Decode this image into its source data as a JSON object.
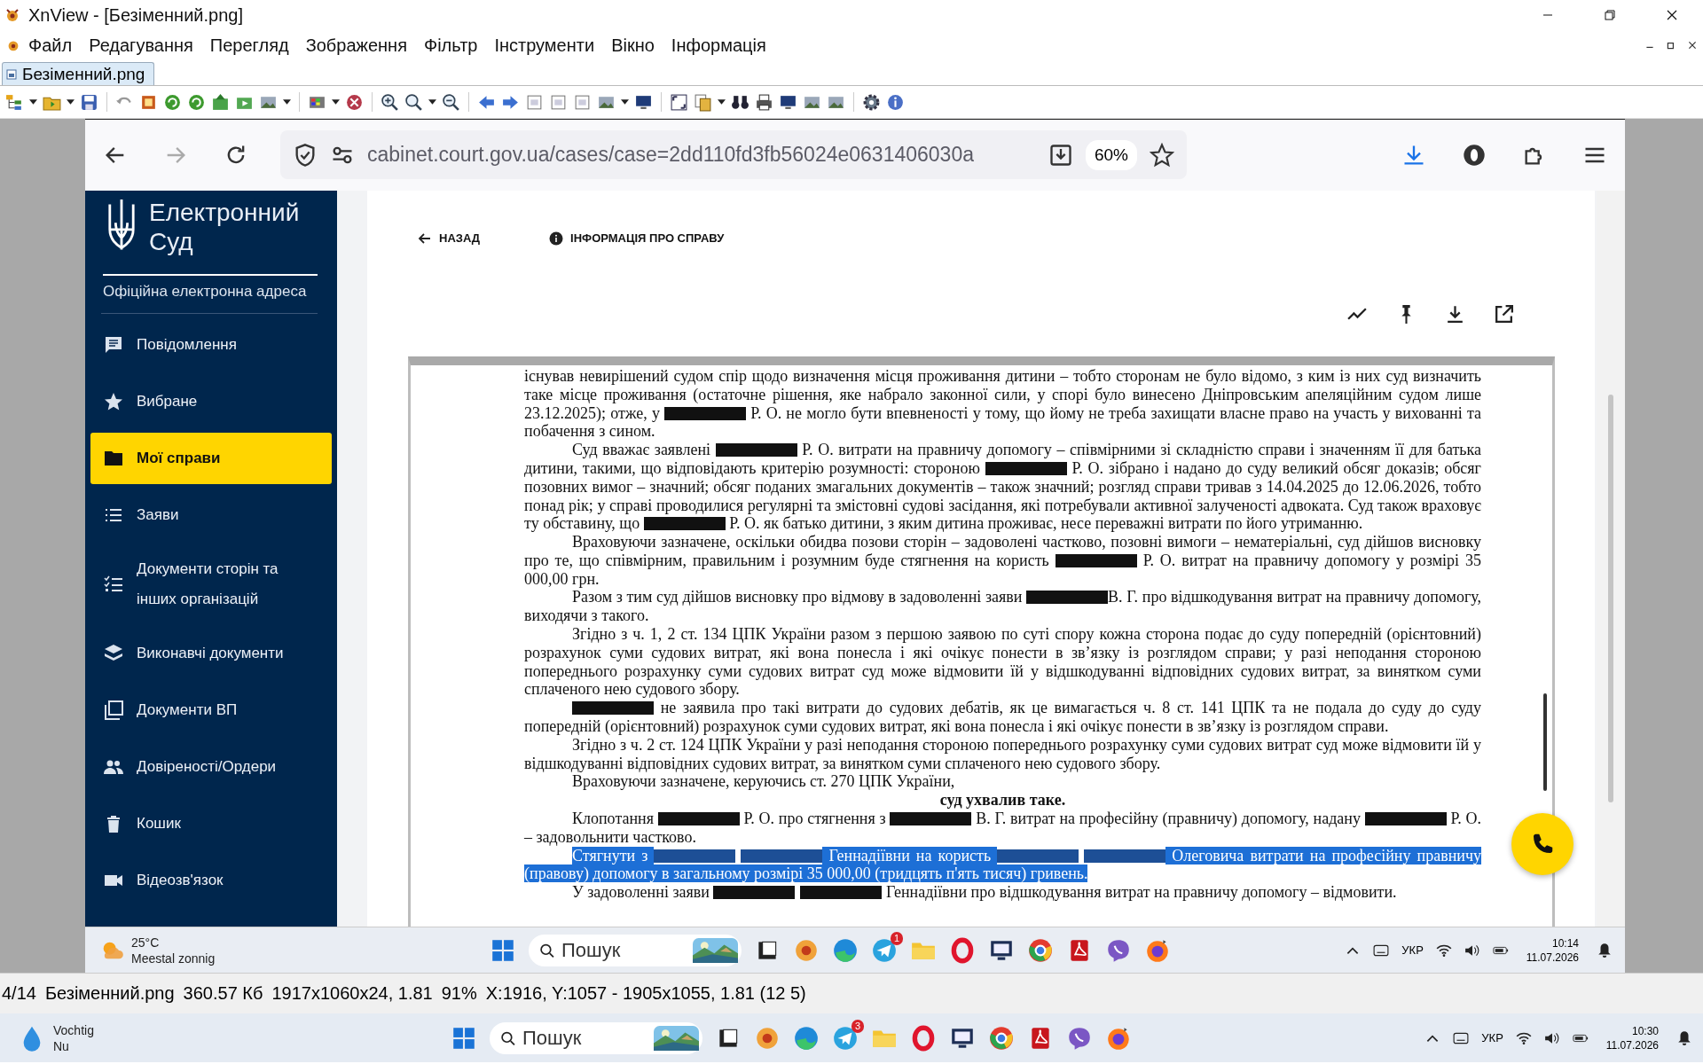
{
  "window": {
    "title": "XnView - [Безіменний.png]"
  },
  "menu": [
    "Файл",
    "Редагування",
    "Перегляд",
    "Зображення",
    "Фільтр",
    "Інструменти",
    "Вікно",
    "Інформація"
  ],
  "tabs": [
    {
      "label": "Безіменний.png",
      "selected": true
    }
  ],
  "browser": {
    "forward_disabled": true,
    "url": "cabinet.court.gov.ua/cases/case=2dd110fd3fb56024e0631406030a",
    "zoom": "60%"
  },
  "sidebar": {
    "logo_lines": [
      "Електронний",
      "Суд"
    ],
    "subtitle": "Офіційна електронна адреса",
    "items": [
      {
        "label": "Повідомлення",
        "selected": false
      },
      {
        "label": "Вибране",
        "selected": false
      },
      {
        "label": "Мої справи",
        "selected": true
      },
      {
        "label": "Заяви",
        "selected": false
      },
      {
        "label": "Документи сторін та інших організацій",
        "selected": false
      },
      {
        "label": "Виконавчі документи",
        "selected": false
      },
      {
        "label": "Документи ВП",
        "selected": false
      },
      {
        "label": "Довіреності/Ордери",
        "selected": false
      },
      {
        "label": "Кошик",
        "selected": false
      },
      {
        "label": "Відеозв'язок",
        "selected": false
      }
    ]
  },
  "page": {
    "back": "НАЗАД",
    "info": "ІНФОРМАЦІЯ ПРО СПРАВУ"
  },
  "document": {
    "paragraphs": [
      {
        "kind": "continuation",
        "highlighted": false,
        "parts": [
          "існував невирішений судом спір щодо визначення місця проживання дитини – тобто сторонам не було відомо, з ким із них суд визначить таке місце проживання (остаточне рішення, яке набрало законної сили, у спорі було винесено Дніпровським апеляційним судом лише 23.12.2025); отже, у ",
          {
            "kind": "redaction"
          },
          " Р. О. не могло бути впевненості у тому, що йому не треба захищати власне право на участь у вихованні та побачення з сином."
        ]
      },
      {
        "kind": "paragraph",
        "highlighted": false,
        "parts": [
          "Суд вважає заявлені ",
          {
            "kind": "redaction"
          },
          " Р. О. витрати на правничу допомогу – співмірними зі складністю справи і значенням її для батька дитини, такими, що відповідають критерію розумності: стороною ",
          {
            "kind": "redaction"
          },
          " Р. О. зібрано і надано до суду великий обсяг доказів; обсяг позовних вимог – значний; обсяг поданих змагальних документів – також значний; розгляд справи тривав з 14.04.2025 до 12.06.2026, тобто понад рік; у справі проводилися регулярні та змістовні судові засідання, які потребували активної залученості адвоката. Суд також враховує ту обставину, що ",
          {
            "kind": "redaction"
          },
          " Р. О. як батько дитини, з яким дитина проживає, несе переважні витрати по його утриманню."
        ]
      },
      {
        "kind": "paragraph",
        "highlighted": false,
        "parts": [
          "Враховуючи зазначене, оскільки обидва позови сторін – задоволені частково, позовні вимоги – нематеріальні, суд дійшов висновку про те, що співмірним, правильним і розумним буде стягнення на користь ",
          {
            "kind": "redaction"
          },
          " Р. О. витрат на правничу допомогу у розмірі 35 000,00 грн."
        ]
      },
      {
        "kind": "paragraph",
        "highlighted": false,
        "parts": [
          "Разом з тим суд дійшов висновку про відмову в задоволенні заяви ",
          {
            "kind": "redaction"
          },
          "В. Г. про відшкодування витрат на правничу допомогу, виходячи з такого."
        ]
      },
      {
        "kind": "paragraph",
        "highlighted": false,
        "parts": [
          "Згідно з ч. 1, 2 ст. 134 ЦПК України разом з першою заявою по суті спору кожна сторона подає до суду попередній (орієнтовний) розрахунок суми судових витрат, які вона понесла і які очікує понести в зв’язку із розглядом справи; у разі неподання стороною попереднього розрахунку суми судових витрат суд може відмовити їй у відшкодуванні відповідних судових витрат, за винятком суми сплаченого нею судового збору."
        ]
      },
      {
        "kind": "paragraph",
        "highlighted": false,
        "parts": [
          {
            "kind": "redaction"
          },
          " не заявила про такі витрати до судових дебатів, як це вимагається ч. 8 ст. 141 ЦПК та не подала до суду до суду попередній (орієнтовний) розрахунок суми судових витрат, які вона понесла і які очікує понести в зв’язку із розглядом справи."
        ]
      },
      {
        "kind": "paragraph",
        "highlighted": false,
        "parts": [
          "Згідно з ч. 2 ст. 124 ЦПК України у разі неподання стороною попереднього розрахунку суми судових витрат суд може відмовити їй у відшкодуванні відповідних судових витрат, за винятком суми сплаченого нею судового збору."
        ]
      },
      {
        "kind": "paragraph",
        "highlighted": false,
        "parts": [
          "Враховуючи зазначене, керуючись ст. 270 ЦПК України,"
        ]
      },
      {
        "kind": "heading",
        "highlighted": false,
        "parts": [
          "суд ухвалив таке."
        ]
      },
      {
        "kind": "paragraph",
        "highlighted": false,
        "parts": [
          "Клопотання ",
          {
            "kind": "redaction"
          },
          " Р. О. про стягнення з ",
          {
            "kind": "redaction"
          },
          " В. Г. витрат на професійну (правничу) допомогу, надану ",
          {
            "kind": "redaction"
          },
          " Р. О. – задовольнити частково."
        ]
      },
      {
        "kind": "paragraph",
        "highlighted": true,
        "parts": [
          "Стягнути з ",
          {
            "kind": "redaction"
          },
          {
            "kind": "redaction"
          },
          " Геннадіївни на користь ",
          {
            "kind": "redaction"
          },
          {
            "kind": "redaction"
          },
          " Олеговича витрати на професійну правничу (правову) допомогу в загальному розмірі 35 000,00 (тридцять п'ять тисяч) гривень."
        ]
      },
      {
        "kind": "paragraph",
        "highlighted": false,
        "parts": [
          "У задоволенні заяви ",
          {
            "kind": "redaction"
          },
          {
            "kind": "redaction"
          },
          " Геннадіївни про відшкодування витрат на правничу допомогу – відмовити."
        ]
      }
    ]
  },
  "inner_taskbar": {
    "temperature": "25°C",
    "weather": "Meestal zonnig",
    "search": {
      "placeholder": "Пошук"
    },
    "badge": "1",
    "language": "УКР",
    "time": "10:14",
    "date": "11.07.2026"
  },
  "status_bar": [
    "4/14",
    "Безіменний.png",
    "360.57 Кб",
    "1917x1060x24, 1.81",
    "91%",
    "X:1916, Y:1057 - 1905x1055, 1.81 (12 5)"
  ],
  "taskbar": {
    "weather": "Vochtig",
    "weather_detail": "Nu",
    "search": {
      "placeholder": "Пошук"
    },
    "badge": "3",
    "language": "УКР",
    "time": "10:30",
    "date": "11.07.2026"
  }
}
